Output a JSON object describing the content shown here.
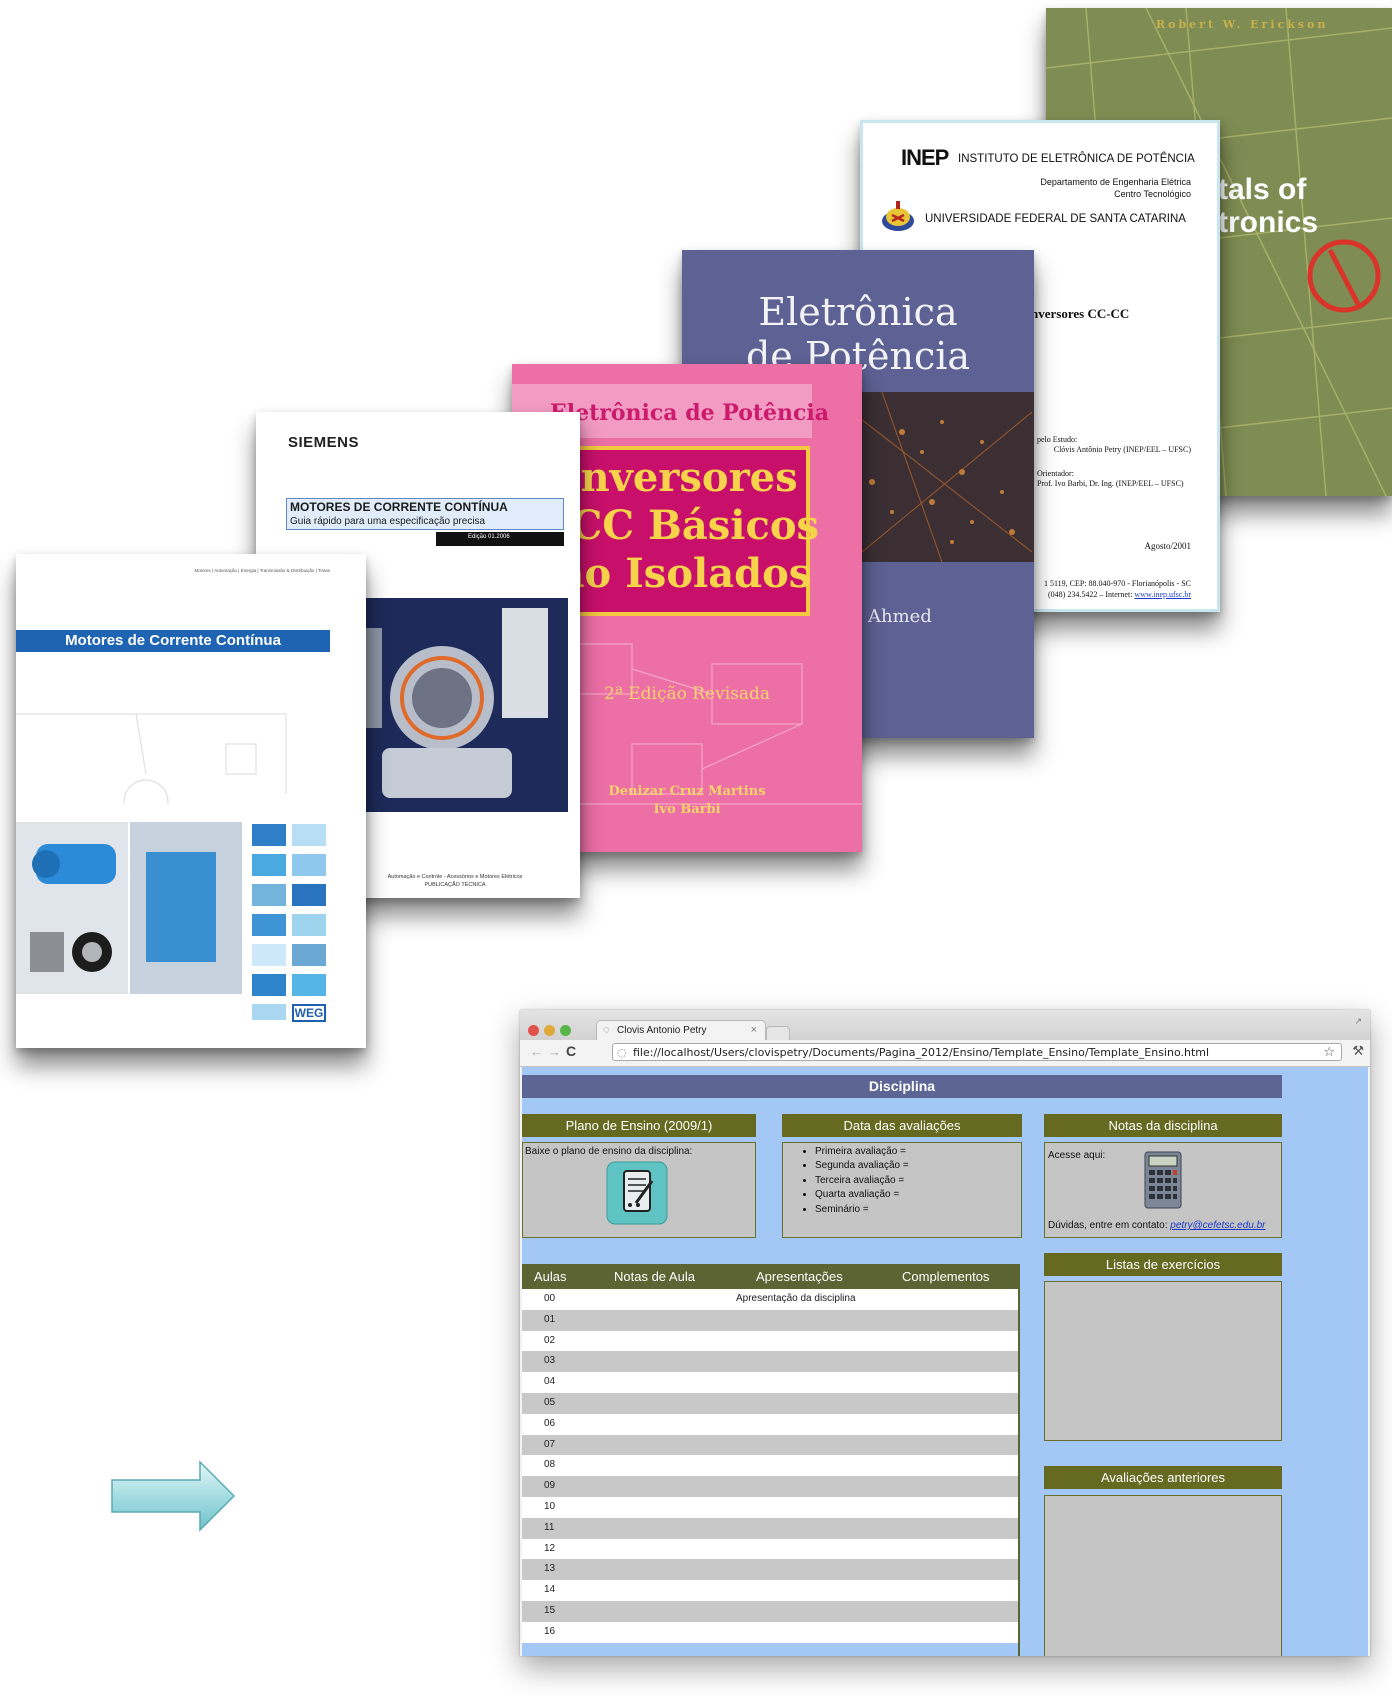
{
  "covers": {
    "fundamentals": {
      "author": "Robert W. Erickson",
      "title_fragment_1": "tals of",
      "title_fragment_2": "tronics"
    },
    "inep": {
      "logo": "INEP",
      "institute": "INSTITUTO DE ELETRÔNICA DE POTÊNCIA",
      "department": "Departamento de Engenharia Elétrica",
      "center": "Centro Tecnológico",
      "university": "UNIVERSIDADE FEDERAL DE SANTA CATARINA",
      "title_fragment": "nversores CC-CC",
      "study_label": "pelo Estudo:",
      "study_name": "Clóvis Antônio Petry (INEP/EEL – UFSC)",
      "advisor_label": "Orientador:",
      "advisor_name": "Prof. Ivo Barbi, Dr. Ing. (INEP/EEL – UFSC)",
      "date": "Agosto/2001",
      "address": "1 5119, CEP: 88.040-970 - Florianópolis - SC",
      "phone": "(048) 234.5422 – Internet:",
      "site": "www.inep.ufsc.br"
    },
    "eletronica": {
      "title_line1": "Eletrônica",
      "title_line2": "de Potência",
      "author_fragment": "Ahmed"
    },
    "pink": {
      "top_title": "Eletrônica de Potência",
      "line1": "Conversores",
      "line2": "C-CC Básicos",
      "line3": "Não Isolados",
      "edition": "2ª Edição Revisada",
      "author1": "Denizar Cruz Martins",
      "author2": "Ivo Barbi"
    },
    "siemens": {
      "brand": "SIEMENS",
      "title": "MOTORES DE CORRENTE CONTÍNUA",
      "subtitle": "Guia rápido para uma especificação precisa",
      "edition": "Edição 01.2006",
      "footer1": "Automação e Controle - Acessórios e Motores Elétricos",
      "footer2": "PUBLICAÇÃO TÉCNICA"
    },
    "weg": {
      "top_text": "Motores | Automação | Energia | Transmissão & Distribuição | Tintas",
      "title": "Motores de Corrente Contínua",
      "logo": "WEG"
    }
  },
  "browser": {
    "tab_title": "Clovis Antonio Petry",
    "url": "file://localhost/Users/clovispetry/Documents/Pagina_2012/Ensino/Template_Ensino/Template_Ensino.html",
    "page": {
      "banner": "Disciplina",
      "plano": {
        "title": "Plano de Ensino (2009/1)",
        "text": "Baixe o plano de ensino da disciplina:"
      },
      "avaliacoes": {
        "title": "Data das avaliações",
        "items": [
          "Primeira avaliação =",
          "Segunda avaliação =",
          "Terceira avaliação =",
          "Quarta avaliação =",
          "Seminário ="
        ]
      },
      "notas": {
        "title": "Notas da disciplina",
        "access": "Acesse aqui:",
        "contact": "Dúvidas, entre em contato:",
        "email": "petry@cefetsc.edu.br"
      },
      "table": {
        "headers": [
          "Aulas",
          "Notas de Aula",
          "Apresentações",
          "Complementos"
        ],
        "rows": [
          {
            "num": "00",
            "text": "Apresentação da disciplina"
          },
          {
            "num": "01",
            "text": ""
          },
          {
            "num": "02",
            "text": ""
          },
          {
            "num": "03",
            "text": ""
          },
          {
            "num": "04",
            "text": ""
          },
          {
            "num": "05",
            "text": ""
          },
          {
            "num": "06",
            "text": ""
          },
          {
            "num": "07",
            "text": ""
          },
          {
            "num": "08",
            "text": ""
          },
          {
            "num": "09",
            "text": ""
          },
          {
            "num": "10",
            "text": ""
          },
          {
            "num": "11",
            "text": ""
          },
          {
            "num": "12",
            "text": ""
          },
          {
            "num": "13",
            "text": ""
          },
          {
            "num": "14",
            "text": ""
          },
          {
            "num": "15",
            "text": ""
          },
          {
            "num": "16",
            "text": ""
          }
        ]
      },
      "listas": {
        "title": "Listas de exercícios"
      },
      "anteriores": {
        "title": "Avaliações anteriores"
      }
    }
  },
  "colors": {
    "header_olive": "#656a20",
    "page_bg": "#a3c8f6",
    "banner": "#5c6594",
    "box_gray": "#c5c5c5"
  }
}
